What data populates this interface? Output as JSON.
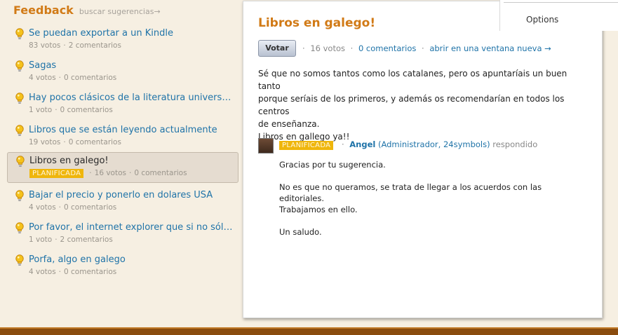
{
  "header": {
    "title": "Feedback",
    "search_link": "buscar sugerencias→"
  },
  "colors": {
    "accent": "#d17a16",
    "link": "#1f73a8",
    "badge": "#efb60c"
  },
  "options": {
    "label": "Options"
  },
  "suggestions": [
    {
      "title": "Se puedan exportar a un Kindle",
      "votes": "83 votos",
      "comments": "2 comentarios"
    },
    {
      "title": "Sagas",
      "votes": "4 votos",
      "comments": "0 comentarios"
    },
    {
      "title": "Hay pocos clásicos de la literatura universal…",
      "votes": "1 voto",
      "comments": "0 comentarios"
    },
    {
      "title": "Libros que se están leyendo actualmente",
      "votes": "19 votos",
      "comments": "0 comentarios"
    },
    {
      "title": "Libros en galego!",
      "badge": "PLANIFICADA",
      "votes": "16 votos",
      "comments": "0 comentarios"
    },
    {
      "title": "Bajar el precio y ponerlo en dolares USA",
      "votes": "4 votos",
      "comments": "0 comentarios"
    },
    {
      "title": "Por favor, el internet explorer que si no sólo…",
      "votes": "1 voto",
      "comments": "2 comentarios"
    },
    {
      "title": "Porfa, algo en galego",
      "votes": "4 votos",
      "comments": "0 comentarios"
    }
  ],
  "detail": {
    "title": "Libros en galego!",
    "vote_button": "Votar",
    "votes": "16 votos",
    "comments_link": "0 comentarios",
    "open_window_link": "abrir en una ventana nueva →",
    "body": "Sé que no somos tantos como los catalanes, pero os apuntaríais un buen tanto\nporque seríais de los primeros, y además os recomendarían en todos los centros\nde enseñanza.\nLibros en gallego ya!!",
    "response": {
      "badge": "PLANIFICADA",
      "author": "Angel",
      "role": "(Administrador, 24symbols)",
      "verb": "respondido",
      "text": "Gracias por tu sugerencia.\n\nNo es que no queramos, se trata de llegar a los acuerdos con las editoriales.\nTrabajamos en ello.\n\nUn saludo."
    }
  }
}
